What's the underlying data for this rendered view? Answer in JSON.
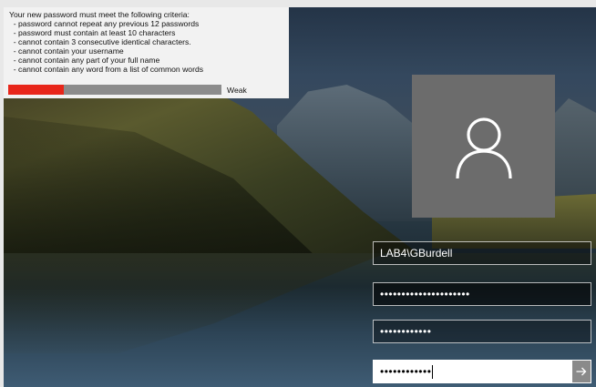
{
  "criteria": {
    "lines": [
      "Your new password must meet the following criteria:",
      "  - password cannot repeat any previous 12 passwords",
      "  - password must contain at least 10 characters",
      "  - cannot contain 3 consecutive identical characters.",
      "  - cannot contain your username",
      "  - cannot contain any part of your full name",
      "  - cannot contain any word from a list of common words"
    ],
    "strength_label": "Weak",
    "strength_fraction": 0.26,
    "strength_color": "#e8261a"
  },
  "login": {
    "username": "LAB4\\GBurdell",
    "current_password_mask": "•••••••••••••••••••••",
    "new_password_mask": "••••••••••••",
    "confirm_password_mask": "••••••••••••"
  },
  "icons": {
    "avatar": "user-silhouette-icon",
    "submit": "arrow-right-icon"
  }
}
